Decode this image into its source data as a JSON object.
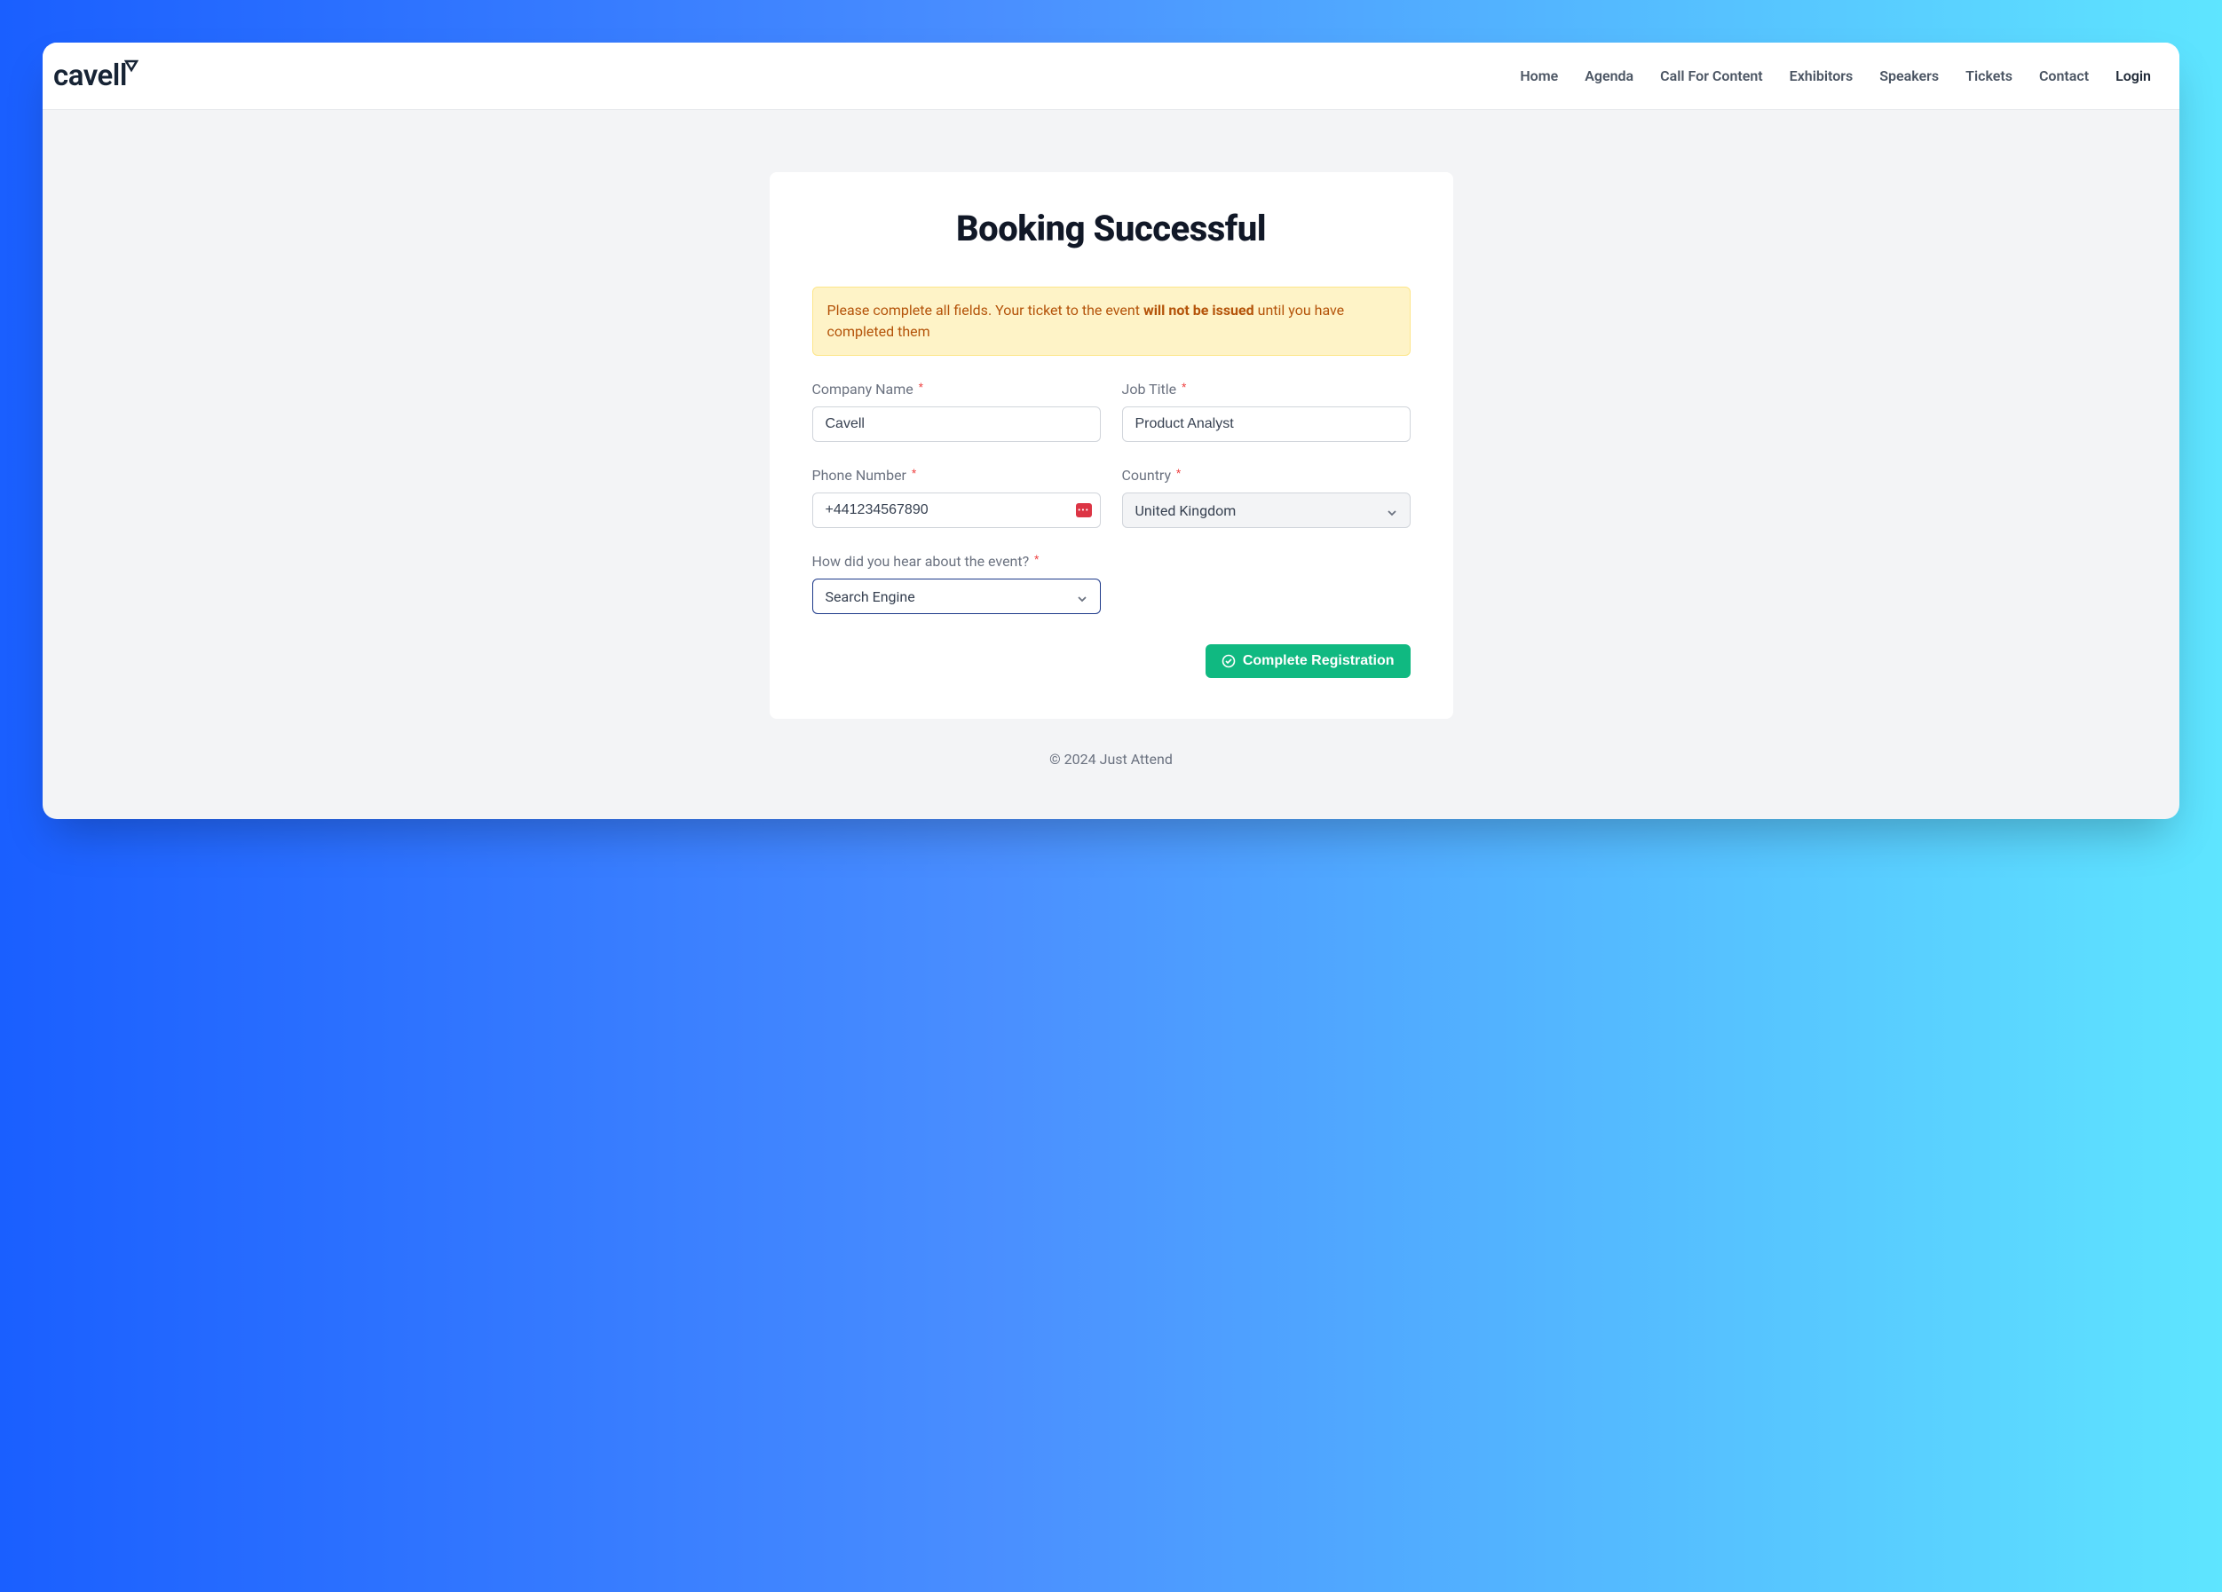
{
  "logo": {
    "text": "cavell"
  },
  "nav": {
    "home": "Home",
    "agenda": "Agenda",
    "cfc": "Call For Content",
    "exhibitors": "Exhibitors",
    "speakers": "Speakers",
    "tickets": "Tickets",
    "contact": "Contact",
    "login": "Login"
  },
  "page": {
    "title": "Booking Successful"
  },
  "alert": {
    "pre": "Please complete all fields. Your ticket to the event ",
    "bold": "will not be issued",
    "post": " until you have completed them"
  },
  "form": {
    "company": {
      "label": "Company Name",
      "value": "Cavell"
    },
    "job": {
      "label": "Job Title",
      "value": "Product Analyst"
    },
    "phone": {
      "label": "Phone Number",
      "value": "+441234567890"
    },
    "country": {
      "label": "Country",
      "selected": "United Kingdom"
    },
    "heard": {
      "label": "How did you hear about the event?",
      "selected": "Search Engine"
    },
    "submit": "Complete Registration",
    "required_marker": "*"
  },
  "footer": {
    "text": "© 2024 Just Attend"
  }
}
